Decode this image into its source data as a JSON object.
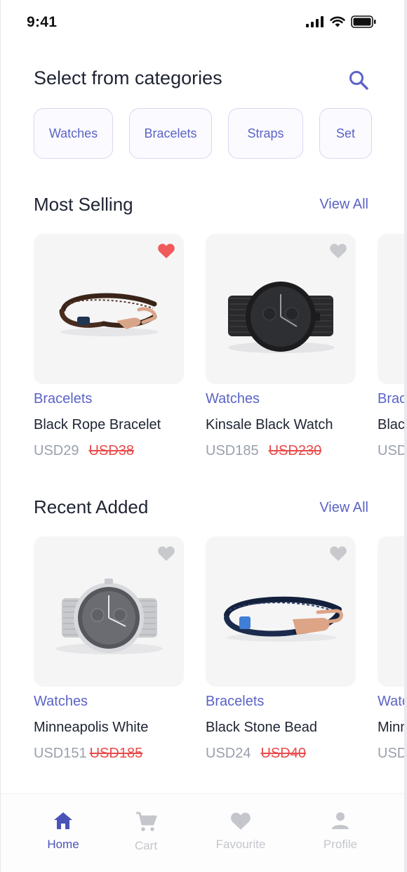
{
  "status_bar": {
    "time": "9:41"
  },
  "header": {
    "title": "Select from categories"
  },
  "categories": [
    "Watches",
    "Bracelets",
    "Straps",
    "Set"
  ],
  "most_selling": {
    "title": "Most Selling",
    "view_all": "View All",
    "products": [
      {
        "category": "Bracelets",
        "name": "Black Rope Bracelet",
        "price": "USD29",
        "old_price": "USD38",
        "favourite": true
      },
      {
        "category": "Watches",
        "name": "Kinsale Black Watch",
        "price": "USD185",
        "old_price": "USD230",
        "favourite": false
      },
      {
        "category": "Bracelets",
        "name": "Black",
        "price": "USD",
        "old_price": "",
        "favourite": false
      }
    ]
  },
  "recent_added": {
    "title": "Recent Added",
    "view_all": "View All",
    "products": [
      {
        "category": "Watches",
        "name": "Minneapolis White",
        "price": "USD151",
        "old_price": "USD185",
        "favourite": false
      },
      {
        "category": "Bracelets",
        "name": "Black Stone Bead",
        "price": "USD24",
        "old_price": "USD40",
        "favourite": false
      },
      {
        "category": "Watches",
        "name": "Minn",
        "price": "USD",
        "old_price": "",
        "favourite": false
      }
    ]
  },
  "tabbar": {
    "items": [
      {
        "label": "Home",
        "icon": "home-icon",
        "active": true
      },
      {
        "label": "Cart",
        "icon": "cart-icon",
        "active": false
      },
      {
        "label": "Favourite",
        "icon": "heart-icon",
        "active": false
      },
      {
        "label": "Profile",
        "icon": "user-icon",
        "active": false
      }
    ]
  },
  "colors": {
    "accent": "#5b63c6",
    "sale": "#e84b4b",
    "favourite": "#f05a5a",
    "muted": "#c4c6cc"
  }
}
